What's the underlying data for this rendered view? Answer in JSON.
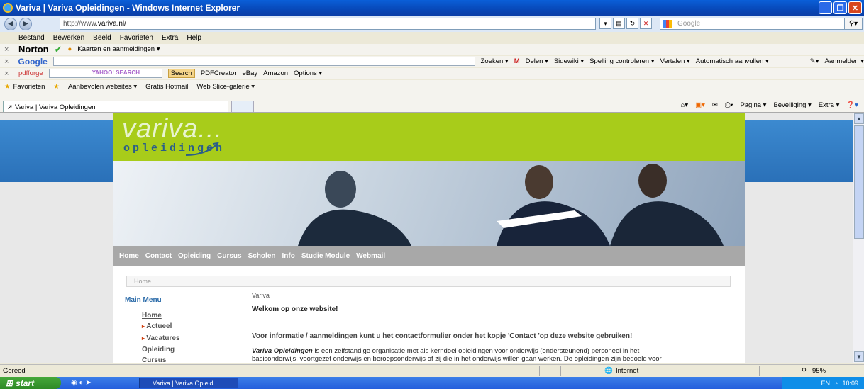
{
  "window": {
    "title": "Variva | Variva Opleidingen - Windows Internet Explorer"
  },
  "address": {
    "prefix": "http://www.",
    "domain": "variva.nl/",
    "search_placeholder": "Google"
  },
  "menu": [
    "Bestand",
    "Bewerken",
    "Beeld",
    "Favorieten",
    "Extra",
    "Help"
  ],
  "norton": {
    "label": "Norton",
    "item": "Kaarten en aanmeldingen ▾"
  },
  "google_toolbar": {
    "logo": "Google",
    "items": [
      "Zoeken ▾",
      "Delen ▾",
      "Sidewiki ▾",
      "Spelling controleren ▾",
      "Vertalen ▾",
      "Automatisch aanvullen ▾"
    ],
    "signin": "Aanmelden ▾"
  },
  "pdf_toolbar": {
    "logo": "pdfforge",
    "yahoo": "YAHOO! SEARCH",
    "search_btn": "Search",
    "items": [
      "PDFCreator",
      "eBay",
      "Amazon",
      "Options ▾"
    ]
  },
  "favbar": {
    "label": "Favorieten",
    "items": [
      "Aanbevolen websites ▾",
      "Gratis Hotmail",
      "Web Slice-galerie ▾"
    ]
  },
  "tab": {
    "label": "Variva | Variva Opleidingen"
  },
  "commandbar": [
    "Pagina ▾",
    "Beveiliging ▾",
    "Extra ▾"
  ],
  "site": {
    "logo_main": "variva...",
    "logo_sub": "opleidingen",
    "nav": [
      "Home",
      "Contact",
      "Opleiding",
      "Cursus",
      "Scholen",
      "Info",
      "Studie Module",
      "Webmail"
    ],
    "breadcrumb": "Home",
    "menu_title": "Main Menu",
    "side_items": [
      "Home",
      "Actueel",
      "Vacatures",
      "Opleiding",
      "Cursus"
    ],
    "content": {
      "section": "Variva",
      "heading": "Welkom op onze website!",
      "info": "Voor informatie / aanmeldingen kunt u het contactformulier onder het kopje 'Contact 'op deze website gebruiken!",
      "para_bold": "Variva Opleidingen",
      "para_line1": " is een zelfstandige organisatie met als kerndoel opleidingen voor onderwijs (ondersteunend) personeel in het",
      "para_line2": "basisonderwijs, voortgezet onderwijs en beroepsonderwijs of zij die in het onderwijs willen gaan werken. De opleidingen zijn bedoeld voor"
    }
  },
  "status": {
    "left": "Gereed",
    "zone": "Internet",
    "zoom": "95%"
  },
  "taskbar": {
    "start": "start",
    "item": "Variva | Variva Opleid...",
    "lang": "EN",
    "clock": "10:09"
  }
}
